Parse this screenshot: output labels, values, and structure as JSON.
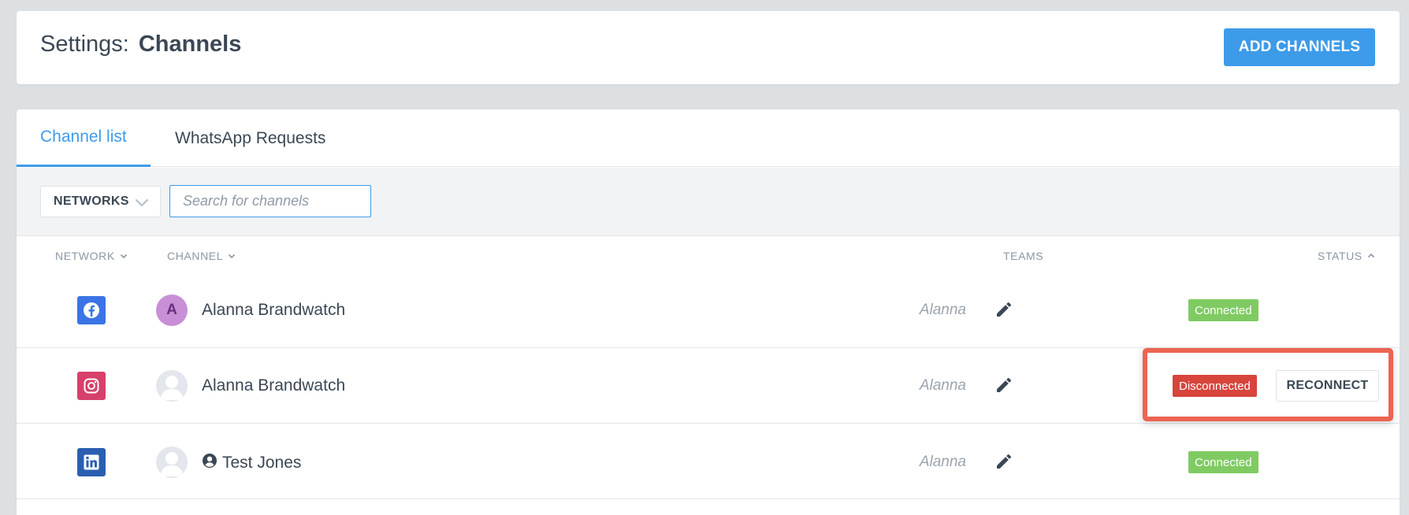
{
  "colors": {
    "accent": "#3d9be9",
    "connected": "#7fcb62",
    "disconnected": "#d7453b",
    "highlight": "#ec6452",
    "facebook": "#3b74e5",
    "instagram": "#d6406b",
    "linkedin": "#2a5fb0"
  },
  "header": {
    "title_prefix": "Settings:",
    "title": "Channels",
    "add_button": "ADD CHANNELS"
  },
  "tabs": [
    {
      "label": "Channel list",
      "active": true
    },
    {
      "label": "WhatsApp Requests",
      "active": false
    }
  ],
  "filters": {
    "networks_label": "NETWORKS",
    "search_placeholder": "Search for channels",
    "search_value": ""
  },
  "columns": {
    "network": "NETWORK",
    "channel": "CHANNEL",
    "teams": "TEAMS",
    "status": "STATUS"
  },
  "rows": [
    {
      "network_icon": "facebook-icon",
      "avatar": {
        "type": "letter",
        "letter": "A"
      },
      "channel": "Alanna Brandwatch",
      "team": "Alanna",
      "status": "Connected"
    },
    {
      "network_icon": "instagram-icon",
      "avatar": {
        "type": "placeholder"
      },
      "channel": "Alanna Brandwatch",
      "team": "Alanna",
      "status": "Disconnected",
      "action": "RECONNECT"
    },
    {
      "network_icon": "linkedin-icon",
      "avatar": {
        "type": "placeholder"
      },
      "channel_icon": "user-circle-icon",
      "channel": "Test Jones",
      "team": "Alanna",
      "status": "Connected"
    }
  ]
}
